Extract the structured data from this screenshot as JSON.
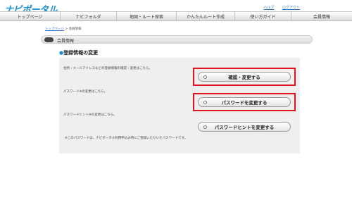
{
  "header": {
    "logo": "ナビポータル",
    "links": [
      "ヘルプ",
      "ログアウト"
    ]
  },
  "nav": {
    "items": [
      "トップページ",
      "ナビフォルダ",
      "地図・ルート探索",
      "かんたんルート作成",
      "使い方ガイド",
      "会員情報"
    ]
  },
  "breadcrumb": {
    "home": "トップページ",
    "separator": " > ",
    "current": "会員情報"
  },
  "page": {
    "title": "会員情報",
    "section_title": "登録情報の変更"
  },
  "rows": {
    "row1_label": "住所・メールアドレスなどの登録情報の確認・変更はこちら。",
    "row1_button": "確認・変更する",
    "row2_label": "パスワード※の変更はこちら。",
    "row2_button": "パスワードを変更する",
    "row3_label": "パスワードヒント※の変更はこちら。",
    "row3_button": "パスワードヒントを変更する"
  },
  "note": "※このパスワードは、ナビポータル利用申込み時にご登録いただいたパスワードです。",
  "colors": {
    "accent": "#1a8fd8",
    "highlight": "#e0141e"
  }
}
